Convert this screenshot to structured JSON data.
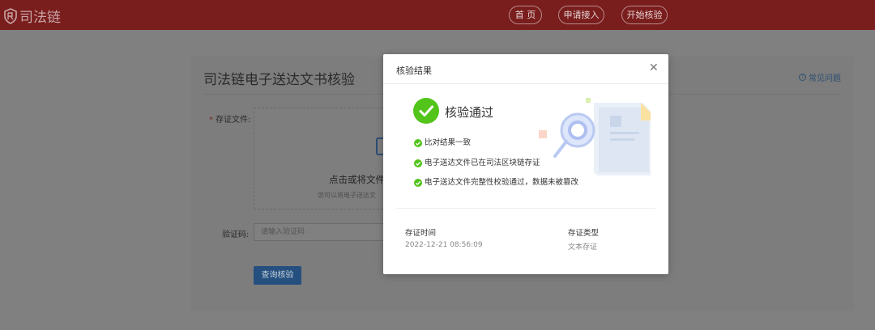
{
  "header": {
    "logo_text": "司法链",
    "nav": [
      "首 页",
      "申请接入",
      "开始核验"
    ]
  },
  "page": {
    "title": "司法链电子送达文书核验",
    "faq_label": "常见问题",
    "file_label": "存证文件:",
    "dropzone_text": "点击或将文件",
    "dropzone_subtext": "您可以将电子送达文",
    "code_label": "验证码:",
    "code_placeholder": "请输入验证码",
    "query_button": "查询核验"
  },
  "modal": {
    "title": "核验结果",
    "status": "核验通过",
    "checks": [
      "比对结果一致",
      "电子送达文件已在司法区块链存证",
      "电子送达文件完整性校验通过，数据未被篡改"
    ],
    "meta": [
      {
        "label": "存证时间",
        "value": "2022-12-21 08:56:09"
      },
      {
        "label": "存证类型",
        "value": "文本存证"
      }
    ]
  },
  "colors": {
    "header_bg": "#7a1d1d",
    "success": "#52c41a",
    "primary_button": "#244f7e"
  }
}
